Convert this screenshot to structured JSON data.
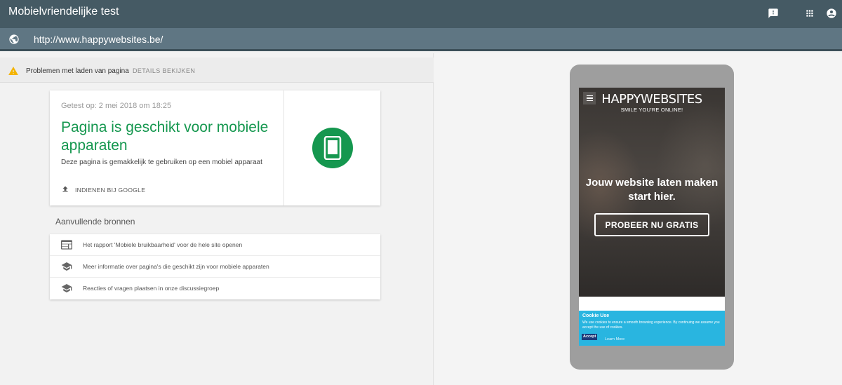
{
  "header": {
    "title": "Mobielvriendelijke test",
    "icons": [
      "feedback-icon",
      "apps-grid-icon",
      "account-icon"
    ]
  },
  "urlbar": {
    "url": "http://www.happywebsites.be/",
    "icon": "globe-icon"
  },
  "warning": {
    "icon": "warning-icon",
    "text": "Problemen met laden van pagina",
    "link": "DETAILS BEKIJKEN",
    "color": "#f4b400"
  },
  "result": {
    "tested_on": "Getest op: 2 mei 2018 om 18:25",
    "headline": "Pagina is geschikt voor mobiele apparaten",
    "description": "Deze pagina is gemakkelijk te gebruiken op een mobiel apparaat",
    "submit_label": "INDIENEN BIJ GOOGLE",
    "status_color": "#15974f",
    "status_icon": "mobile-phone-icon"
  },
  "resources": {
    "title": "Aanvullende bronnen",
    "items": [
      {
        "icon": "web-report-icon",
        "label": "Het rapport 'Mobiele bruikbaarheid' voor de hele site openen"
      },
      {
        "icon": "school-icon",
        "label": "Meer informatie over pagina's die geschikt zijn voor mobiele apparaten"
      },
      {
        "icon": "school-icon",
        "label": "Reacties of vragen plaatsen in onze discussiegroep"
      }
    ]
  },
  "preview": {
    "logo_line1": "HAPPYWEBSITES",
    "logo_line2": "SMILE YOU'RE ONLINE!",
    "hero_heading": "Jouw website laten maken start hier.",
    "cta_label": "PROBEER NU GRATIS",
    "cookie": {
      "title": "Cookie Use",
      "text": "We use cookies to ensure a smooth browsing experience. By continuing we assume you accept the use of cookies.",
      "accept": "Accept",
      "more": "Learn More",
      "color": "#29b5e0"
    }
  }
}
